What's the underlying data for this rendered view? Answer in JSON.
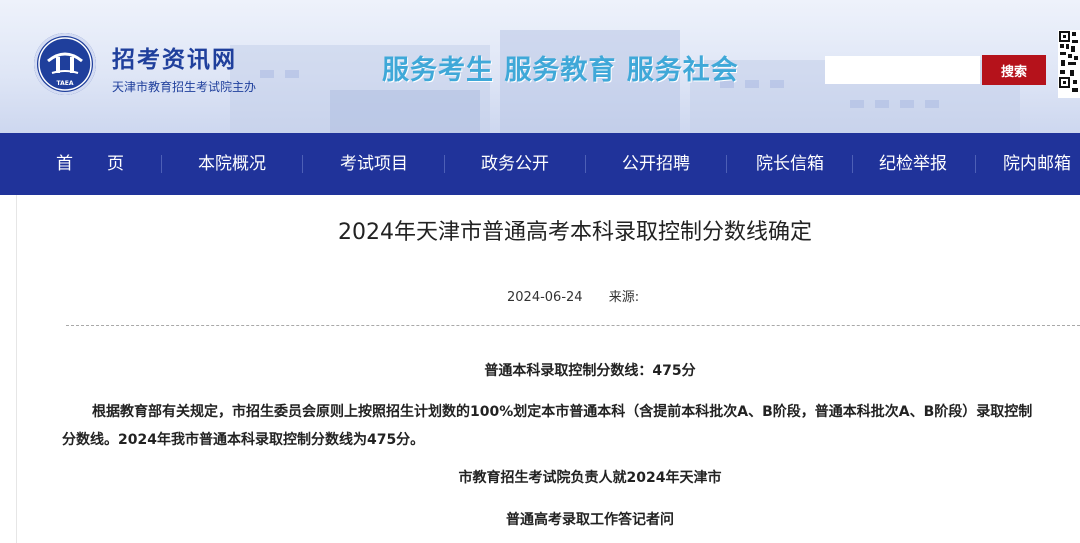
{
  "header": {
    "site_name": "招考资讯网",
    "site_subtitle": "天津市教育招生考试院主办",
    "logo_text": "TAEA",
    "slogan": "服务考生  服务教育  服务社会",
    "search": {
      "placeholder": "",
      "button_label": "搜索"
    }
  },
  "nav": {
    "items": [
      {
        "label": "首　　页"
      },
      {
        "label": "本院概况"
      },
      {
        "label": "考试项目"
      },
      {
        "label": "政务公开"
      },
      {
        "label": "公开招聘"
      },
      {
        "label": "院长信箱"
      },
      {
        "label": "纪检举报"
      },
      {
        "label": "院内邮箱"
      }
    ]
  },
  "article": {
    "title": "2024年天津市普通高考本科录取控制分数线确定",
    "date": "2024-06-24",
    "source_label": "来源:",
    "subtitle": "普通本科录取控制分数线：475分",
    "body_line1": "根据教育部有关规定，市招生委员会原则上按照招生计划数的100%划定本市普通本科（含提前本科批次A、B阶段，普通本科批次A、B阶段）录取控制",
    "body_line2": "分数线。2024年我市普通本科录取控制分数线为475分。",
    "section_heading_1": "市教育招生考试院负责人就2024年天津市",
    "section_heading_2": "普通高考录取工作答记者问"
  },
  "colors": {
    "brand_blue": "#1f3f9c",
    "nav_bg": "#20339a",
    "slogan": "#3fa8d8",
    "search_button": "#b5121b"
  },
  "icons": [
    "taea-logo-icon",
    "qr-code-icon"
  ]
}
